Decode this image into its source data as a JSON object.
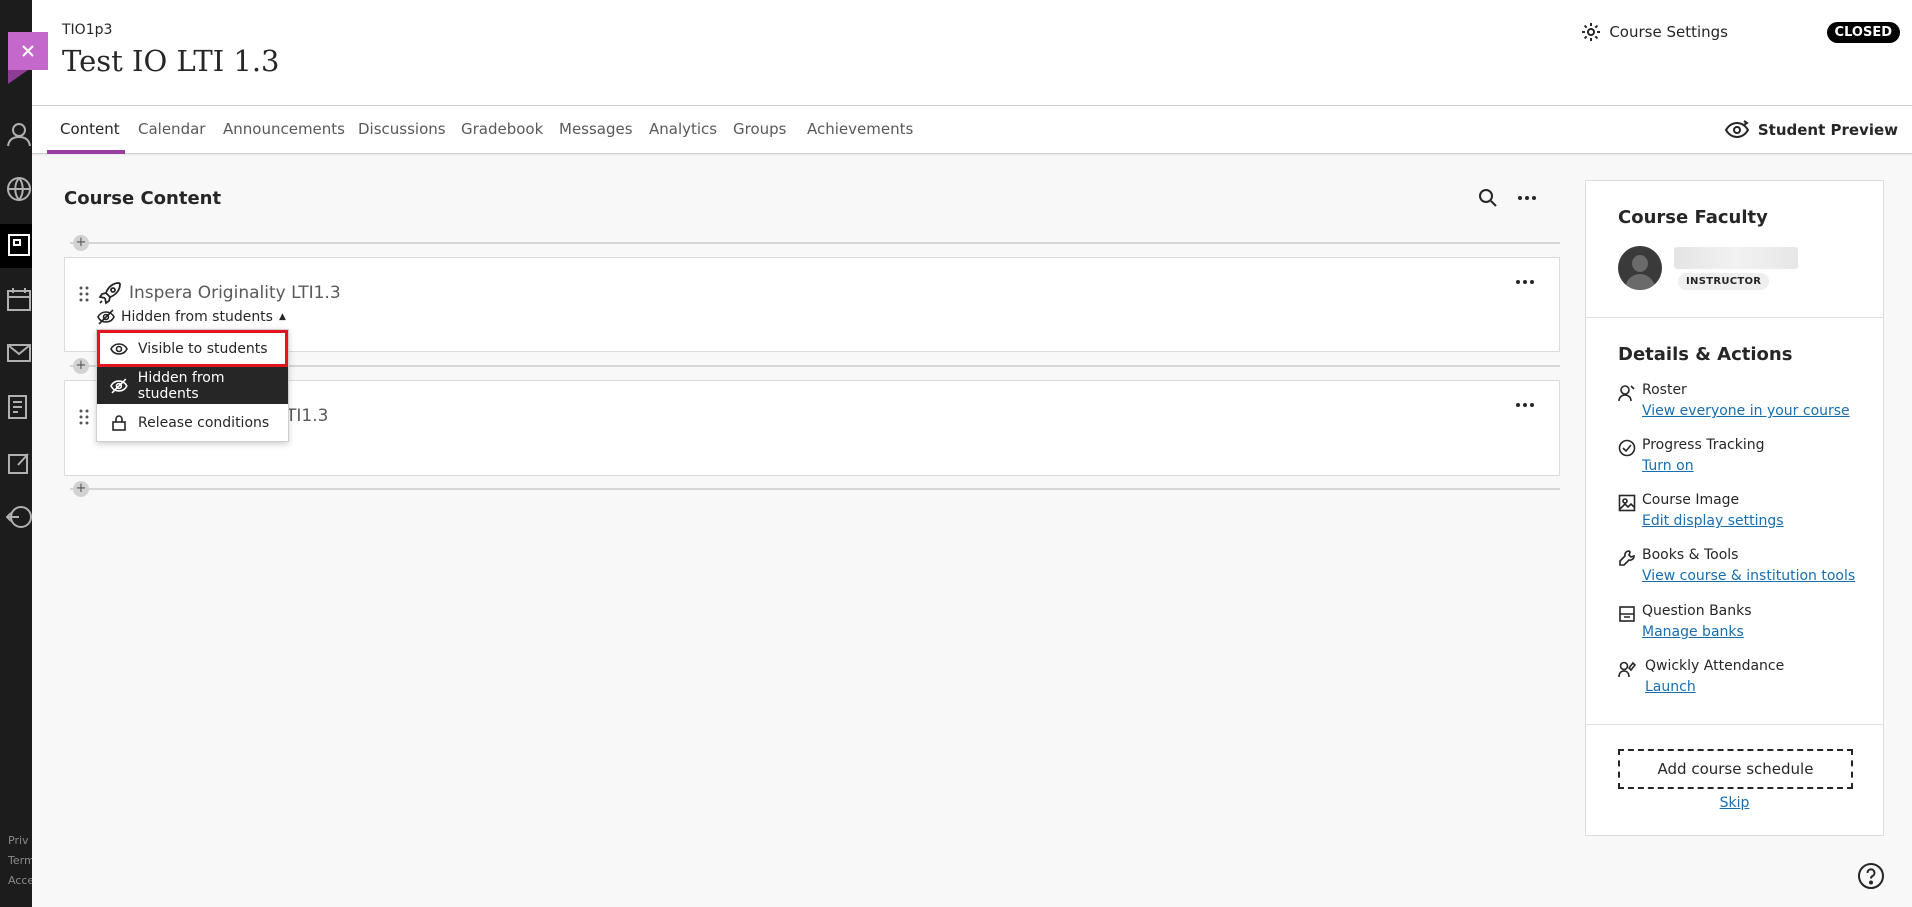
{
  "rail": {
    "footer_items": [
      "Priv",
      "Term",
      "Acce"
    ]
  },
  "header": {
    "course_code": "TIO1p3",
    "course_title": "Test IO LTI 1.3",
    "settings_label": "Course Settings",
    "status_badge": "CLOSED"
  },
  "nav": {
    "tabs": [
      "Content",
      "Calendar",
      "Announcements",
      "Discussions",
      "Gradebook",
      "Messages",
      "Analytics",
      "Groups",
      "Achievements"
    ],
    "active_tab": "Content",
    "student_preview": "Student Preview"
  },
  "content": {
    "title": "Course Content",
    "items": [
      {
        "title": "Inspera Originality LTI1.3",
        "visibility": "Hidden from students"
      },
      {
        "title": "TI1.3"
      }
    ],
    "dropdown": {
      "options": [
        "Visible to students",
        "Hidden from students",
        "Release conditions"
      ],
      "selected": "Hidden from students",
      "focused": "Visible to students"
    }
  },
  "panel": {
    "faculty_title": "Course Faculty",
    "faculty_role": "INSTRUCTOR",
    "details_title": "Details & Actions",
    "details": [
      {
        "label": "Roster",
        "link": "View everyone in your course",
        "icon": "roster-icon"
      },
      {
        "label": "Progress Tracking",
        "link": "Turn on",
        "icon": "check-circle-icon"
      },
      {
        "label": "Course Image",
        "link": "Edit display settings",
        "icon": "image-icon"
      },
      {
        "label": "Books & Tools",
        "link": "View course & institution tools",
        "icon": "wrench-icon"
      },
      {
        "label": "Question Banks",
        "link": "Manage banks",
        "icon": "bank-icon"
      },
      {
        "label": "Qwickly Attendance",
        "link": "Launch",
        "icon": "attendance-icon"
      }
    ],
    "schedule_button": "Add course schedule",
    "skip_link": "Skip"
  },
  "colors": {
    "accent": "#9a3da2",
    "close_button": "#c468cc",
    "link": "#186eb0",
    "focus_outline": "#e0151f"
  }
}
